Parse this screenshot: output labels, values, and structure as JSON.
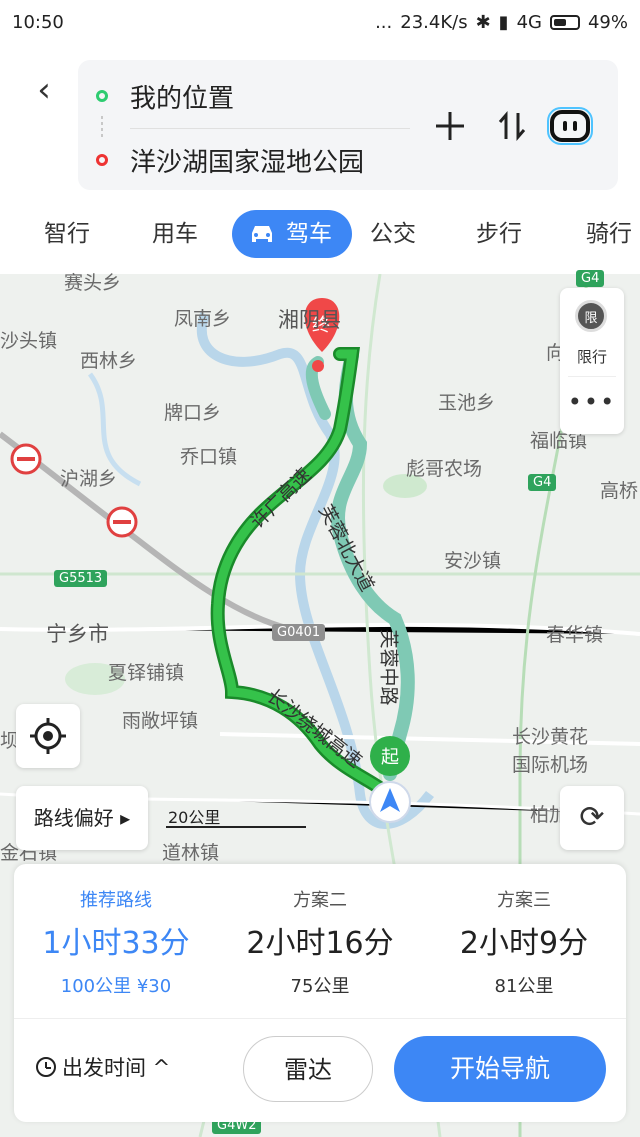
{
  "status_bar": {
    "time": "10:50",
    "dots": "...",
    "network_speed": "23.4K/s",
    "signal_text": "4G",
    "battery": "49%"
  },
  "search": {
    "origin": "我的位置",
    "destination": "洋沙湖国家湿地公园"
  },
  "modes": [
    {
      "label": "智行"
    },
    {
      "label": "用车"
    },
    {
      "label": "驾车",
      "active": true
    },
    {
      "label": "公交"
    },
    {
      "label": "步行"
    },
    {
      "label": "骑行"
    }
  ],
  "map": {
    "labels": {
      "l1": "赛头乡",
      "l2": "凤南乡",
      "l3": "湘阴县",
      "l4": "沙头镇",
      "l5": "西林乡",
      "l6": "玉池乡",
      "l7": "牌口乡",
      "l8": "福临镇",
      "l9": "乔口镇",
      "l10": "彪哥农场",
      "l11": "沪湖乡",
      "l12": "高桥",
      "l13": "安沙镇",
      "l14": "宁乡市",
      "l15": "春华镇",
      "l16": "夏铎铺镇",
      "l17": "雨敞坪镇",
      "l18": "长沙黄花",
      "l19": "国际机场",
      "l20": "道林镇",
      "l21": "柏加",
      "l22": "向",
      "l23": "坝",
      "l24": "金石镇"
    },
    "road_names": {
      "r1": "许广高速",
      "r2": "芙蓉北大道",
      "r3": "芙蓉中路",
      "r4": "长沙绕城高速"
    },
    "badges": {
      "g4a": "G4",
      "g4b": "G4",
      "g5513": "G5513",
      "g0401": "G0401",
      "g4w2": "G4W2"
    },
    "markers": {
      "end": "终",
      "start": "起"
    },
    "limit_badge": "限",
    "limit_label": "限行",
    "more": "•••",
    "route_pref": "路线偏好 ▸",
    "scale": "20公里",
    "refresh": "⟳"
  },
  "plans": [
    {
      "name": "推荐路线",
      "time": "1小时33分",
      "meta": "100公里  ¥30",
      "selected": true
    },
    {
      "name": "方案二",
      "time": "2小时16分",
      "meta": "75公里"
    },
    {
      "name": "方案三",
      "time": "2小时9分",
      "meta": "81公里"
    }
  ],
  "actions": {
    "depart": "出发时间 ^",
    "radar": "雷达",
    "navigate": "开始导航"
  },
  "colors": {
    "accent": "#3d87f5",
    "route_primary": "#2fb04a",
    "route_alt": "#7fc9b4",
    "end_marker": "#f04848",
    "start_marker": "#2fb04a"
  }
}
